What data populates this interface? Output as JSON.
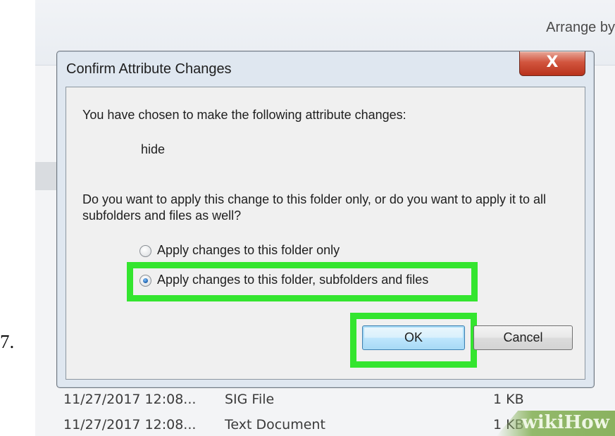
{
  "step_number": "7.",
  "explorer": {
    "arrange_label": "Arrange by",
    "rows": [
      {
        "date": "11/27/2017 12:08...",
        "type": "SIG File",
        "size": "1 KB"
      },
      {
        "date": "11/27/2017 12:08...",
        "type": "Text Document",
        "size": "1 KB"
      }
    ]
  },
  "dialog": {
    "title": "Confirm Attribute Changes",
    "close_glyph": "X",
    "message": "You have chosen to make the following attribute changes:",
    "attribute": "hide",
    "question": "Do you want to apply this change to this folder only, or do you want to apply it to all subfolders and files as well?",
    "options": [
      {
        "label": "Apply changes to this folder only",
        "selected": false
      },
      {
        "label": "Apply changes to this folder, subfolders and files",
        "selected": true
      }
    ],
    "ok_label": "OK",
    "cancel_label": "Cancel"
  },
  "watermark": "wikiHow",
  "colors": {
    "highlight": "#34e52f",
    "close_button": "#c9432b",
    "ok_button_border": "#3c7fb1"
  }
}
